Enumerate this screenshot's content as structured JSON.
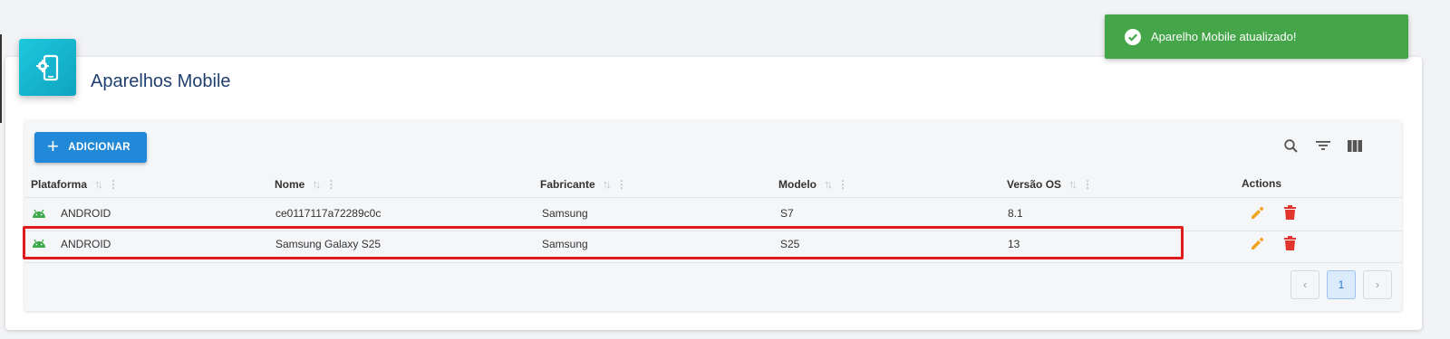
{
  "toast": {
    "message": "Aparelho Mobile atualizado!",
    "icon": "check-circle-icon"
  },
  "page": {
    "title": "Aparelhos Mobile",
    "icon": "mobile-settings-icon"
  },
  "toolbar": {
    "add_label": "ADICIONAR",
    "icons": [
      "search-icon",
      "filter-icon",
      "columns-icon"
    ]
  },
  "table": {
    "columns": [
      "Plataforma",
      "Nome",
      "Fabricante",
      "Modelo",
      "Versão OS",
      "Actions"
    ],
    "rows": [
      {
        "platform": "ANDROID",
        "name": "ce0117117a72289c0c",
        "manufacturer": "Samsung",
        "model": "S7",
        "os_version": "8.1"
      },
      {
        "platform": "ANDROID",
        "name": "Samsung Galaxy S25",
        "manufacturer": "Samsung",
        "model": "S25",
        "os_version": "13"
      }
    ]
  },
  "pagination": {
    "prev": "‹",
    "current": "1",
    "next": "›"
  },
  "colors": {
    "accent": "#2288d8",
    "toast": "#45a549",
    "edit": "#f0a21d",
    "delete": "#e2332d",
    "android": "#3dab4a",
    "highlight": "#e01b1b"
  }
}
